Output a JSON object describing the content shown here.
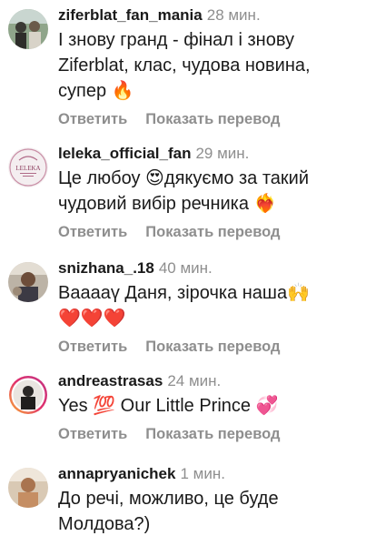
{
  "comments": [
    {
      "username": "ziferblat_fan_mania",
      "time": "28 мин.",
      "lines": [
        "І знову гранд - фінал і знову",
        "Ziferblat, клас, чудова новина,",
        "супер 🔥"
      ],
      "reply_label": "Ответить",
      "translate_label": "Показать перевод",
      "avatar_icon": "photo-avatar-icon"
    },
    {
      "username": "leleka_official_fan",
      "time": "29 мин.",
      "lines": [
        "Це любоу 😍дякуємо за такий",
        "чудовий вибір речника ❤️‍🔥"
      ],
      "reply_label": "Ответить",
      "translate_label": "Показать перевод",
      "avatar_icon": "leleka-logo-avatar-icon",
      "avatar_text": "LELEKA"
    },
    {
      "username": "snizhana_.18",
      "time": "40 мин.",
      "lines": [
        "Вааааү Даня, зірочка наша🙌",
        "❤️❤️❤️"
      ],
      "reply_label": "Ответить",
      "translate_label": "Показать перевод",
      "avatar_icon": "photo-avatar-icon"
    },
    {
      "username": "andreastrasas",
      "time": "24 мин.",
      "lines": [
        "Yes 💯 Our Little Prince 💞"
      ],
      "reply_label": "Ответить",
      "translate_label": "Показать перевод",
      "avatar_icon": "story-ring-avatar-icon"
    },
    {
      "username": "annapryanichek",
      "time": "1 мин.",
      "lines": [
        "До речі, можливо, це буде",
        "Молдова?)"
      ],
      "avatar_icon": "photo-avatar-icon"
    }
  ]
}
